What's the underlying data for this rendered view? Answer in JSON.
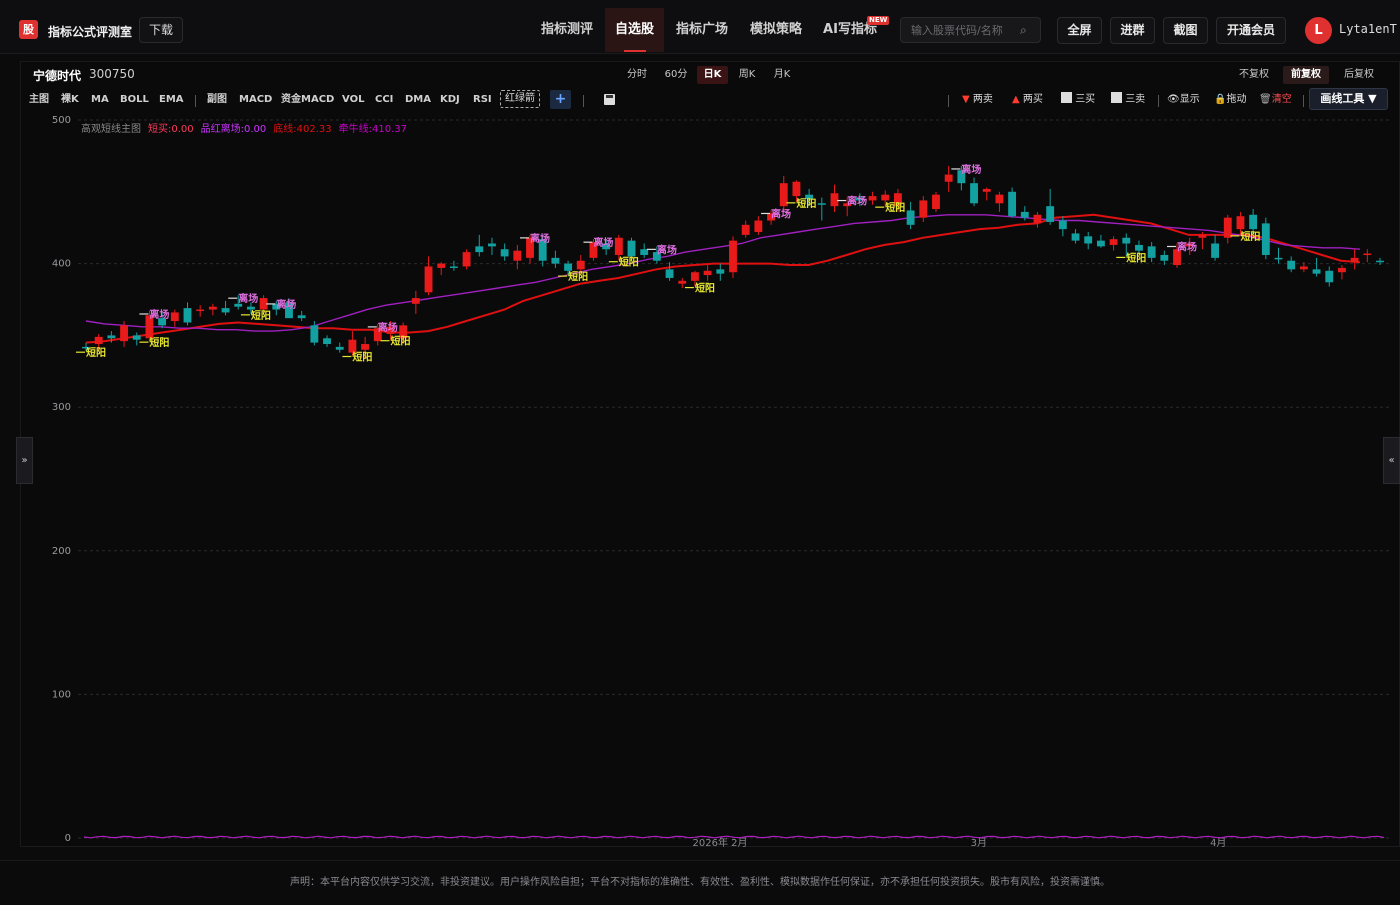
{
  "app": {
    "logo_char": "股",
    "name": "指标公式评测室",
    "download": "下载"
  },
  "nav": [
    {
      "label": "指标测评",
      "active": false
    },
    {
      "label": "自选股",
      "active": true
    },
    {
      "label": "指标广场",
      "active": false
    },
    {
      "label": "模拟策略",
      "active": false
    },
    {
      "label": "AI写指标",
      "active": false,
      "badge": "NEW"
    }
  ],
  "search": {
    "placeholder": "输入股票代码/名称",
    "icon": "search-icon"
  },
  "top_buttons": [
    "全屏",
    "进群",
    "截图",
    "开通会员"
  ],
  "user": {
    "avatar": "L",
    "name": "Lyta1enT"
  },
  "stock": {
    "name": "宁德时代",
    "code": "300750"
  },
  "periods": [
    {
      "label": "分时",
      "active": false
    },
    {
      "label": "60分",
      "active": false
    },
    {
      "label": "日K",
      "active": true
    },
    {
      "label": "周K",
      "active": false
    },
    {
      "label": "月K",
      "active": false
    }
  ],
  "adjust": [
    {
      "label": "不复权",
      "active": false
    },
    {
      "label": "前复权",
      "active": true
    },
    {
      "label": "后复权",
      "active": false
    }
  ],
  "main_tools": [
    "主图",
    "裸K",
    "MA",
    "BOLL",
    "EMA"
  ],
  "sub_tools": [
    "副图",
    "MACD",
    "资金MACD",
    "VOL",
    "CCI",
    "DMA",
    "KDJ",
    "RSI"
  ],
  "special_tool": "红绿箭",
  "right_tools": [
    {
      "label": "两卖",
      "icon": "down-triangle-icon",
      "color": "#ff3b30"
    },
    {
      "label": "两买",
      "icon": "up-triangle-icon",
      "color": "#ff3b30"
    },
    {
      "label": "三买",
      "icon": "trend-up-icon",
      "color": "#ddd"
    },
    {
      "label": "三卖",
      "icon": "trend-down-icon",
      "color": "#ddd"
    },
    {
      "label": "显示",
      "icon": "eye-icon",
      "color": "#ddd"
    },
    {
      "label": "拖动",
      "icon": "lock-icon",
      "color": "#ddd"
    },
    {
      "label": "清空",
      "icon": "trash-icon",
      "color": "#ff4d4f"
    }
  ],
  "draw_tool": "画线工具 ▼",
  "legend": [
    {
      "text": "高观短线主图",
      "color": "#888888"
    },
    {
      "text": "短买:0.00",
      "color": "#ff3b5c"
    },
    {
      "text": "品红离场:0.00",
      "color": "#cc33ff"
    },
    {
      "text": "底线:402.33",
      "color": "#e01010"
    },
    {
      "text": "牵牛线:410.37",
      "color": "#cc00cc"
    }
  ],
  "sidebar_toggles": {
    "left": "»",
    "right": "«"
  },
  "chart_data": {
    "type": "candlestick",
    "y_ticks": [
      0,
      100,
      200,
      300,
      400,
      500
    ],
    "ylim": [
      0,
      500
    ],
    "x_ticks": [
      "2026年 2月",
      "3月",
      "4月"
    ],
    "candles": [
      {
        "o": 342,
        "h": 345,
        "l": 339,
        "c": 341
      },
      {
        "o": 344,
        "h": 351,
        "l": 339,
        "c": 349
      },
      {
        "o": 350,
        "h": 353,
        "l": 345,
        "c": 348
      },
      {
        "o": 346,
        "h": 360,
        "l": 342,
        "c": 357
      },
      {
        "o": 350,
        "h": 352,
        "l": 343,
        "c": 347
      },
      {
        "o": 348,
        "h": 367,
        "l": 346,
        "c": 364
      },
      {
        "o": 362,
        "h": 366,
        "l": 355,
        "c": 357
      },
      {
        "o": 360,
        "h": 368,
        "l": 356,
        "c": 366
      },
      {
        "o": 369,
        "h": 373,
        "l": 357,
        "c": 359
      },
      {
        "o": 367,
        "h": 371,
        "l": 363,
        "c": 368
      },
      {
        "o": 368,
        "h": 372,
        "l": 364,
        "c": 370
      },
      {
        "o": 369,
        "h": 374,
        "l": 364,
        "c": 366
      },
      {
        "o": 372,
        "h": 378,
        "l": 368,
        "c": 370
      },
      {
        "o": 370,
        "h": 373,
        "l": 365,
        "c": 368
      },
      {
        "o": 368,
        "h": 378,
        "l": 365,
        "c": 376
      },
      {
        "o": 372,
        "h": 374,
        "l": 364,
        "c": 368
      },
      {
        "o": 373,
        "h": 376,
        "l": 363,
        "c": 362
      },
      {
        "o": 364,
        "h": 367,
        "l": 360,
        "c": 362
      },
      {
        "o": 357,
        "h": 360,
        "l": 343,
        "c": 345
      },
      {
        "o": 348,
        "h": 350,
        "l": 342,
        "c": 344
      },
      {
        "o": 342,
        "h": 345,
        "l": 338,
        "c": 340
      },
      {
        "o": 338,
        "h": 353,
        "l": 336,
        "c": 347
      },
      {
        "o": 340,
        "h": 349,
        "l": 334,
        "c": 344
      },
      {
        "o": 346,
        "h": 358,
        "l": 343,
        "c": 355
      },
      {
        "o": 351,
        "h": 360,
        "l": 347,
        "c": 356
      },
      {
        "o": 348,
        "h": 359,
        "l": 344,
        "c": 357
      },
      {
        "o": 372,
        "h": 381,
        "l": 365,
        "c": 376
      },
      {
        "o": 380,
        "h": 405,
        "l": 378,
        "c": 398
      },
      {
        "o": 397,
        "h": 401,
        "l": 392,
        "c": 400
      },
      {
        "o": 398,
        "h": 402,
        "l": 395,
        "c": 397
      },
      {
        "o": 398,
        "h": 410,
        "l": 396,
        "c": 408
      },
      {
        "o": 412,
        "h": 420,
        "l": 405,
        "c": 408
      },
      {
        "o": 414,
        "h": 418,
        "l": 406,
        "c": 412
      },
      {
        "o": 410,
        "h": 414,
        "l": 402,
        "c": 405
      },
      {
        "o": 402,
        "h": 413,
        "l": 396,
        "c": 409
      },
      {
        "o": 404,
        "h": 420,
        "l": 400,
        "c": 418
      },
      {
        "o": 417,
        "h": 419,
        "l": 398,
        "c": 402
      },
      {
        "o": 404,
        "h": 409,
        "l": 397,
        "c": 400
      },
      {
        "o": 400,
        "h": 402,
        "l": 392,
        "c": 395
      },
      {
        "o": 396,
        "h": 406,
        "l": 393,
        "c": 402
      },
      {
        "o": 404,
        "h": 417,
        "l": 402,
        "c": 415
      },
      {
        "o": 414,
        "h": 417,
        "l": 406,
        "c": 410
      },
      {
        "o": 406,
        "h": 420,
        "l": 402,
        "c": 418
      },
      {
        "o": 416,
        "h": 418,
        "l": 403,
        "c": 405
      },
      {
        "o": 410,
        "h": 414,
        "l": 404,
        "c": 406
      },
      {
        "o": 408,
        "h": 412,
        "l": 400,
        "c": 402
      },
      {
        "o": 396,
        "h": 401,
        "l": 388,
        "c": 390
      },
      {
        "o": 386,
        "h": 390,
        "l": 383,
        "c": 388
      },
      {
        "o": 388,
        "h": 395,
        "l": 384,
        "c": 394
      },
      {
        "o": 392,
        "h": 399,
        "l": 388,
        "c": 395
      },
      {
        "o": 396,
        "h": 400,
        "l": 388,
        "c": 393
      },
      {
        "o": 394,
        "h": 419,
        "l": 390,
        "c": 416
      },
      {
        "o": 420,
        "h": 430,
        "l": 418,
        "c": 427
      },
      {
        "o": 422,
        "h": 433,
        "l": 420,
        "c": 430
      },
      {
        "o": 430,
        "h": 437,
        "l": 427,
        "c": 435
      },
      {
        "o": 440,
        "h": 461,
        "l": 437,
        "c": 456
      },
      {
        "o": 447,
        "h": 458,
        "l": 443,
        "c": 457
      },
      {
        "o": 448,
        "h": 452,
        "l": 440,
        "c": 445
      },
      {
        "o": 442,
        "h": 446,
        "l": 430,
        "c": 441
      },
      {
        "o": 440,
        "h": 455,
        "l": 436,
        "c": 449
      },
      {
        "o": 440,
        "h": 446,
        "l": 433,
        "c": 442
      },
      {
        "o": 446,
        "h": 449,
        "l": 440,
        "c": 444
      },
      {
        "o": 444,
        "h": 450,
        "l": 441,
        "c": 447
      },
      {
        "o": 444,
        "h": 451,
        "l": 440,
        "c": 448
      },
      {
        "o": 440,
        "h": 452,
        "l": 436,
        "c": 449
      },
      {
        "o": 437,
        "h": 443,
        "l": 424,
        "c": 427
      },
      {
        "o": 432,
        "h": 447,
        "l": 429,
        "c": 444
      },
      {
        "o": 438,
        "h": 450,
        "l": 436,
        "c": 448
      },
      {
        "o": 457,
        "h": 468,
        "l": 450,
        "c": 462
      },
      {
        "o": 465,
        "h": 468,
        "l": 451,
        "c": 456
      },
      {
        "o": 456,
        "h": 460,
        "l": 440,
        "c": 442
      },
      {
        "o": 450,
        "h": 453,
        "l": 444,
        "c": 452
      },
      {
        "o": 442,
        "h": 450,
        "l": 436,
        "c": 448
      },
      {
        "o": 450,
        "h": 453,
        "l": 432,
        "c": 433
      },
      {
        "o": 436,
        "h": 440,
        "l": 430,
        "c": 432
      },
      {
        "o": 428,
        "h": 436,
        "l": 425,
        "c": 434
      },
      {
        "o": 440,
        "h": 452,
        "l": 427,
        "c": 429
      },
      {
        "o": 430,
        "h": 433,
        "l": 419,
        "c": 424
      },
      {
        "o": 421,
        "h": 424,
        "l": 414,
        "c": 416
      },
      {
        "o": 419,
        "h": 422,
        "l": 410,
        "c": 414
      },
      {
        "o": 416,
        "h": 420,
        "l": 411,
        "c": 412
      },
      {
        "o": 413,
        "h": 419,
        "l": 409,
        "c": 417
      },
      {
        "o": 418,
        "h": 421,
        "l": 405,
        "c": 414
      },
      {
        "o": 413,
        "h": 416,
        "l": 407,
        "c": 409
      },
      {
        "o": 412,
        "h": 415,
        "l": 401,
        "c": 404
      },
      {
        "o": 406,
        "h": 409,
        "l": 399,
        "c": 402
      },
      {
        "o": 399,
        "h": 414,
        "l": 397,
        "c": 410
      },
      {
        "o": 412,
        "h": 418,
        "l": 406,
        "c": 414
      },
      {
        "o": 418,
        "h": 422,
        "l": 410,
        "c": 420
      },
      {
        "o": 414,
        "h": 420,
        "l": 402,
        "c": 404
      },
      {
        "o": 418,
        "h": 434,
        "l": 414,
        "c": 432
      },
      {
        "o": 424,
        "h": 436,
        "l": 420,
        "c": 433
      },
      {
        "o": 434,
        "h": 438,
        "l": 420,
        "c": 424
      },
      {
        "o": 428,
        "h": 432,
        "l": 403,
        "c": 406
      },
      {
        "o": 404,
        "h": 411,
        "l": 400,
        "c": 403
      },
      {
        "o": 402,
        "h": 405,
        "l": 394,
        "c": 396
      },
      {
        "o": 396,
        "h": 401,
        "l": 394,
        "c": 398
      },
      {
        "o": 396,
        "h": 404,
        "l": 391,
        "c": 393
      },
      {
        "o": 395,
        "h": 398,
        "l": 384,
        "c": 387
      },
      {
        "o": 394,
        "h": 399,
        "l": 389,
        "c": 397
      },
      {
        "o": 401,
        "h": 410,
        "l": 396,
        "c": 404
      },
      {
        "o": 406,
        "h": 410,
        "l": 401,
        "c": 407
      },
      {
        "o": 402,
        "h": 404,
        "l": 399,
        "c": 401
      }
    ],
    "series": [
      {
        "name": "底线",
        "color": "#e01010",
        "values": [
          345,
          346,
          348,
          350,
          352,
          354,
          356,
          358,
          359,
          358,
          357,
          356,
          355,
          355,
          354,
          354,
          352,
          352,
          353,
          356,
          360,
          364,
          368,
          374,
          378,
          382,
          386,
          388,
          390,
          393,
          396,
          398,
          399,
          400,
          400,
          400,
          400,
          399,
          399,
          402,
          406,
          410,
          413,
          415,
          418,
          420,
          422,
          424,
          425,
          427,
          428,
          432,
          433,
          434,
          432,
          430,
          428,
          424,
          420,
          420,
          420,
          420,
          418,
          414,
          410,
          406,
          402,
          401
        ]
      },
      {
        "name": "牵牛线",
        "color": "#a020c0",
        "values": [
          360,
          358,
          357,
          356,
          356,
          355,
          355,
          354,
          354,
          353,
          353,
          354,
          356,
          360,
          364,
          368,
          371,
          373,
          375,
          377,
          379,
          381,
          383,
          385,
          387,
          390,
          393,
          396,
          398,
          400,
          403,
          405,
          408,
          410,
          412,
          414,
          418,
          420,
          422,
          424,
          426,
          428,
          429,
          430,
          432,
          433,
          434,
          434,
          434,
          433,
          432,
          431,
          430,
          430,
          429,
          428,
          427,
          426,
          425,
          424,
          423,
          421,
          419,
          416,
          413,
          412,
          411,
          411,
          410
        ]
      }
    ],
    "markers": [
      {
        "i": 0,
        "text": "短阳"
      },
      {
        "i": 5,
        "text": "离场"
      },
      {
        "i": 5,
        "text": "短阳"
      },
      {
        "i": 12,
        "text": "离场"
      },
      {
        "i": 13,
        "text": "短阳"
      },
      {
        "i": 15,
        "text": "离场"
      },
      {
        "i": 21,
        "text": "短阳"
      },
      {
        "i": 23,
        "text": "离场"
      },
      {
        "i": 24,
        "text": "短阳"
      },
      {
        "i": 35,
        "text": "离场"
      },
      {
        "i": 38,
        "text": "短阳"
      },
      {
        "i": 40,
        "text": "离场"
      },
      {
        "i": 42,
        "text": "短阳"
      },
      {
        "i": 45,
        "text": "离场"
      },
      {
        "i": 48,
        "text": "短阳"
      },
      {
        "i": 54,
        "text": "离场"
      },
      {
        "i": 56,
        "text": "短阳"
      },
      {
        "i": 60,
        "text": "离场"
      },
      {
        "i": 63,
        "text": "短阳"
      },
      {
        "i": 69,
        "text": "离场"
      },
      {
        "i": 82,
        "text": "短阳"
      },
      {
        "i": 86,
        "text": "离场"
      },
      {
        "i": 91,
        "text": "短阳"
      }
    ]
  },
  "footer": "声明：本平台内容仅供学习交流，非投资建议。用户操作风险自担；平台不对指标的准确性、有效性、盈利性、模拟数据作任何保证，亦不承担任何投资损失。股市有风险，投资需谨慎。"
}
